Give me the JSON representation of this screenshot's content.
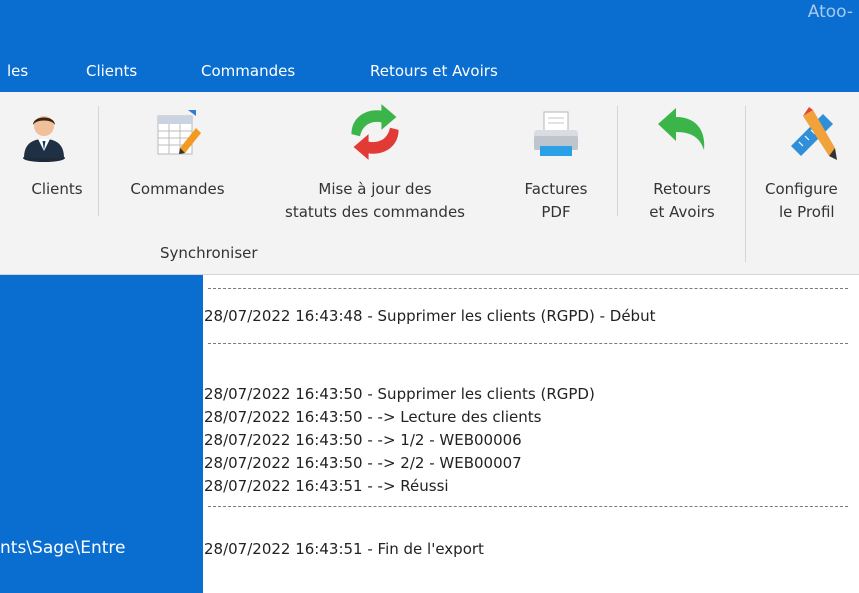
{
  "title_bar": {
    "app_title": "Atoo-"
  },
  "menu": {
    "items": [
      "les",
      "Clients",
      "Commandes",
      "Retours et Avoirs"
    ]
  },
  "ribbon": {
    "buttons": {
      "clients": {
        "line1": "Clients",
        "icon": "user-icon"
      },
      "commandes": {
        "line1": "Commandes",
        "icon": "spreadsheet-edit-icon"
      },
      "sync_status": {
        "line1": "Mise à jour des",
        "line2": "statuts des commandes",
        "icon": "refresh-arrows-icon"
      },
      "factures": {
        "line1": "Factures",
        "line2": "PDF",
        "icon": "printer-icon"
      },
      "retours": {
        "line1": "Retours",
        "line2": "et Avoirs",
        "icon": "undo-arrow-icon"
      },
      "profil": {
        "line1": "Configure",
        "line2": "le Profil",
        "icon": "pencil-ruler-icon"
      }
    },
    "group_label": "Synchroniser"
  },
  "sidebar": {
    "path": "nts\\Sage\\Entre"
  },
  "log": {
    "separator": "--------------------------------------------------------------------------------------",
    "lines": [
      "28/07/2022 16:43:48 - Supprimer les clients (RGPD) - Début",
      "28/07/2022 16:43:50 - Supprimer les clients (RGPD)",
      "28/07/2022 16:43:50 - -> Lecture des clients",
      "28/07/2022 16:43:50 - -> 1/2 - WEB00006",
      "28/07/2022 16:43:50 - -> 2/2 - WEB00007",
      "28/07/2022 16:43:51 - -> Réussi",
      "28/07/2022 16:43:51 - Fin de l'export"
    ]
  },
  "colors": {
    "accent": "#0a6ed1",
    "ribbon_bg": "#f3f3f3"
  }
}
